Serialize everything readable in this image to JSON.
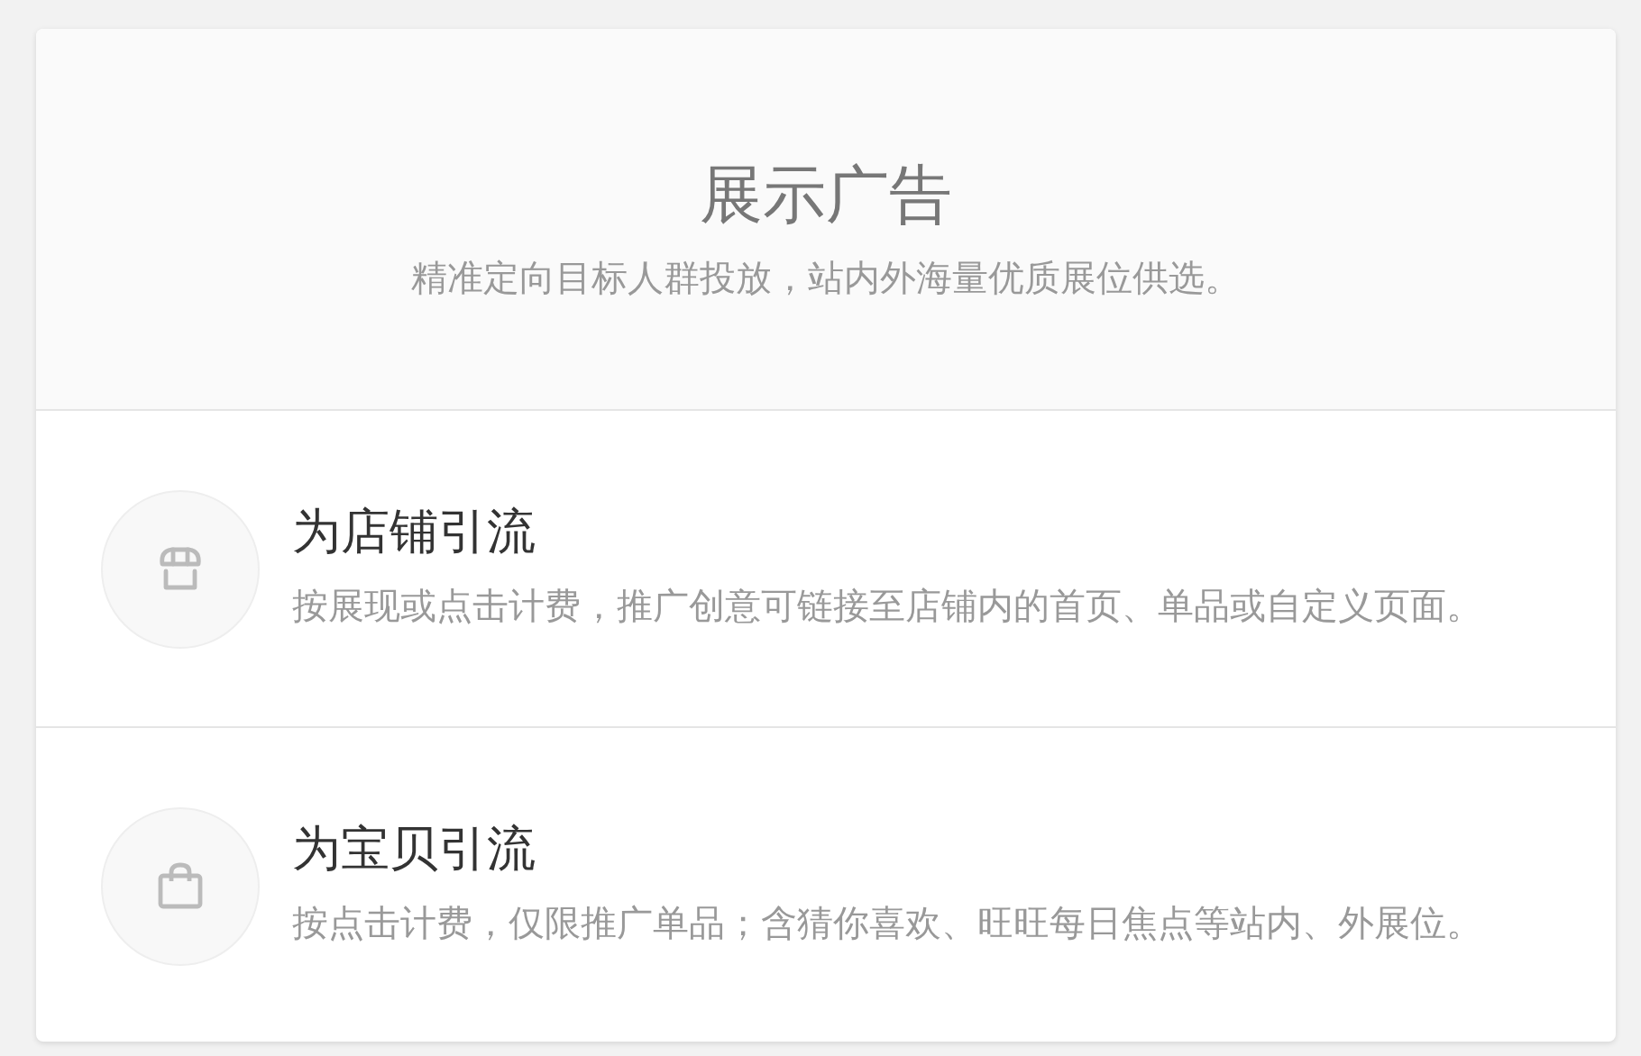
{
  "header": {
    "title": "展示广告",
    "subtitle": "精准定向目标人群投放，站内外海量优质展位供选。"
  },
  "options": [
    {
      "kind": "store",
      "title": "为店铺引流",
      "description": "按展现或点击计费，推广创意可链接至店铺内的首页、单品或自定义页面。"
    },
    {
      "kind": "bag",
      "title": "为宝贝引流",
      "description": "按点击计费，仅限推广单品；含猜你喜欢、旺旺每日焦点等站内、外展位。"
    }
  ]
}
